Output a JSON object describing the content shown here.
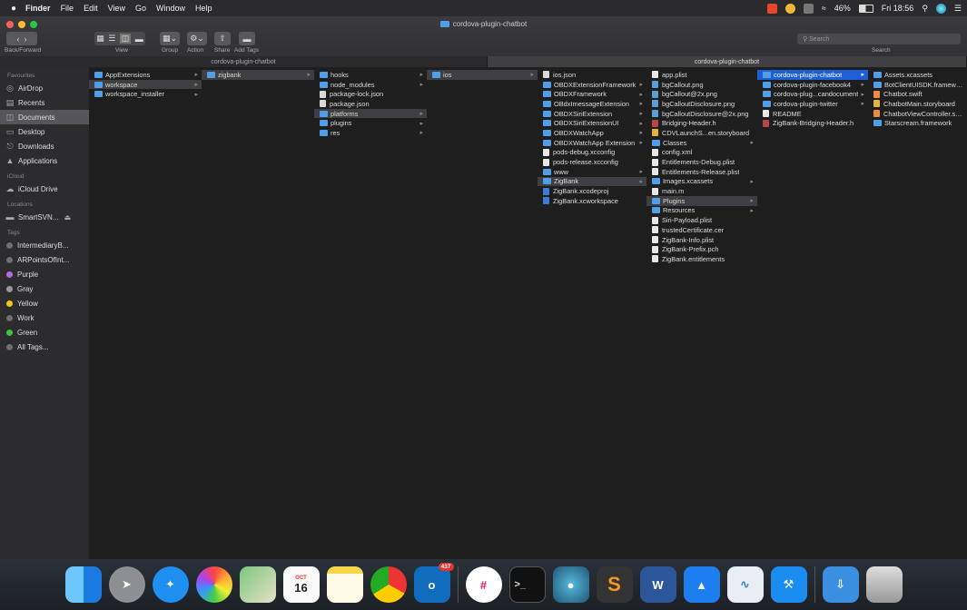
{
  "menubar": {
    "apple": "",
    "items": [
      "Finder",
      "File",
      "Edit",
      "View",
      "Go",
      "Window",
      "Help"
    ],
    "battery": "46%",
    "clock": "Fri 18:56"
  },
  "window": {
    "title": "cordova-plugin-chatbot",
    "toolbar": {
      "back_forward": "Back/Forward",
      "view": "View",
      "group": "Group",
      "action": "Action",
      "share": "Share",
      "add_tags": "Add Tags",
      "search_placeholder": "Search",
      "search_label": "Search"
    },
    "tabs": [
      "cordova-plugin-chatbot",
      "cordova-plugin-chatbot"
    ]
  },
  "sidebar": {
    "favourites_heading": "Favourites",
    "favourites": [
      "AirDrop",
      "Recents",
      "Documents",
      "Desktop",
      "Downloads",
      "Applications"
    ],
    "icloud_heading": "iCloud",
    "icloud": [
      "iCloud Drive"
    ],
    "locations_heading": "Locations",
    "locations": [
      "SmartSVN..."
    ],
    "tags_heading": "Tags",
    "tags": [
      {
        "label": "IntermediaryB...",
        "color": "#6e6e6e"
      },
      {
        "label": "ARPointsOfInt...",
        "color": "#6e6e6e"
      },
      {
        "label": "Purple",
        "color": "#b36ae2"
      },
      {
        "label": "Gray",
        "color": "#9a9a9a"
      },
      {
        "label": "Yellow",
        "color": "#f5c518"
      },
      {
        "label": "Work",
        "color": "#6e6e6e"
      },
      {
        "label": "Green",
        "color": "#3fc43f"
      },
      {
        "label": "All Tags...",
        "color": "#6e6e6e"
      }
    ]
  },
  "columns": [
    {
      "items": [
        {
          "name": "AppExtensions",
          "type": "folder",
          "arrow": true
        },
        {
          "name": "workspace",
          "type": "folder",
          "arrow": true,
          "selected": true
        },
        {
          "name": "workspace_installer",
          "type": "folder",
          "arrow": true
        }
      ]
    },
    {
      "items": [
        {
          "name": "zigbank",
          "type": "folder",
          "arrow": true,
          "selected": true
        }
      ]
    },
    {
      "items": [
        {
          "name": "hooks",
          "type": "folder",
          "arrow": true
        },
        {
          "name": "node_modules",
          "type": "folder",
          "arrow": true
        },
        {
          "name": "package-lock.json",
          "type": "json",
          "arrow": false
        },
        {
          "name": "package.json",
          "type": "json",
          "arrow": false
        },
        {
          "name": "platforms",
          "type": "folder",
          "arrow": true,
          "selected": true
        },
        {
          "name": "plugins",
          "type": "folder",
          "arrow": true
        },
        {
          "name": "res",
          "type": "folder",
          "arrow": true
        }
      ]
    },
    {
      "items": [
        {
          "name": "ios",
          "type": "folder",
          "arrow": true,
          "selected": true
        }
      ]
    },
    {
      "items": [
        {
          "name": "ios.json",
          "type": "json",
          "arrow": false
        },
        {
          "name": "OBDXExtensionFramework",
          "type": "folder",
          "arrow": true
        },
        {
          "name": "OBDXFramework",
          "type": "folder",
          "arrow": true
        },
        {
          "name": "OBdxImessageExtension",
          "type": "folder",
          "arrow": true
        },
        {
          "name": "OBDXSiriExtension",
          "type": "folder",
          "arrow": true
        },
        {
          "name": "OBDXSiriExtensionUI",
          "type": "folder",
          "arrow": true
        },
        {
          "name": "OBDXWatchApp",
          "type": "folder",
          "arrow": true
        },
        {
          "name": "OBDXWatchApp Extension",
          "type": "folder",
          "arrow": true
        },
        {
          "name": "pods-debug.xcconfig",
          "type": "doc",
          "arrow": false
        },
        {
          "name": "pods-release.xcconfig",
          "type": "doc",
          "arrow": false
        },
        {
          "name": "www",
          "type": "folder",
          "arrow": true
        },
        {
          "name": "ZigBank",
          "type": "folder",
          "arrow": true,
          "selected": true
        },
        {
          "name": "ZigBank.xcodeproj",
          "type": "xc",
          "arrow": false
        },
        {
          "name": "ZigBank.xcworkspace",
          "type": "xc",
          "arrow": false
        }
      ]
    },
    {
      "items": [
        {
          "name": "app.plist",
          "type": "doc",
          "arrow": false
        },
        {
          "name": "bgCallout.png",
          "type": "png",
          "arrow": false
        },
        {
          "name": "bgCallout@2x.png",
          "type": "png",
          "arrow": false
        },
        {
          "name": "bgCalloutDisclosure.png",
          "type": "png",
          "arrow": false
        },
        {
          "name": "bgCalloutDisclosure@2x.png",
          "type": "png",
          "arrow": false
        },
        {
          "name": "Bridging-Header.h",
          "type": "h",
          "arrow": false
        },
        {
          "name": "CDVLaunchS...en.storyboard",
          "type": "xib",
          "arrow": false
        },
        {
          "name": "Classes",
          "type": "folder",
          "arrow": true
        },
        {
          "name": "config.xml",
          "type": "doc",
          "arrow": false
        },
        {
          "name": "Entitlements-Debug.plist",
          "type": "doc",
          "arrow": false
        },
        {
          "name": "Entitlements-Release.plist",
          "type": "doc",
          "arrow": false
        },
        {
          "name": "Images.xcassets",
          "type": "folder",
          "arrow": true
        },
        {
          "name": "main.m",
          "type": "doc",
          "arrow": false
        },
        {
          "name": "Plugins",
          "type": "folder",
          "arrow": true,
          "selected": true
        },
        {
          "name": "Resources",
          "type": "folder",
          "arrow": true
        },
        {
          "name": "Siri-Payload.plist",
          "type": "doc",
          "arrow": false
        },
        {
          "name": "trustedCertificate.cer",
          "type": "doc",
          "arrow": false
        },
        {
          "name": "ZigBank-Info.plist",
          "type": "doc",
          "arrow": false
        },
        {
          "name": "ZigBank-Prefix.pch",
          "type": "doc",
          "arrow": false
        },
        {
          "name": "ZigBank.entitlements",
          "type": "doc",
          "arrow": false
        }
      ]
    },
    {
      "items": [
        {
          "name": "cordova-plugin-chatbot",
          "type": "folder",
          "arrow": true,
          "highlight": true
        },
        {
          "name": "cordova-plugin-facebook4",
          "type": "folder",
          "arrow": true
        },
        {
          "name": "cordova-plug...candocument",
          "type": "folder",
          "arrow": true
        },
        {
          "name": "cordova-plugin-twitter",
          "type": "folder",
          "arrow": true
        },
        {
          "name": "README",
          "type": "doc",
          "arrow": false
        },
        {
          "name": "ZigBank-Bridging-Header.h",
          "type": "h",
          "arrow": false
        }
      ]
    },
    {
      "items": [
        {
          "name": "Assets.xcassets",
          "type": "folder",
          "arrow": false
        },
        {
          "name": "BotClientUISDK.framework",
          "type": "folder",
          "arrow": false
        },
        {
          "name": "Chatbot.swift",
          "type": "swift",
          "arrow": false
        },
        {
          "name": "ChatbotMain.storyboard",
          "type": "xib",
          "arrow": false
        },
        {
          "name": "ChatbotViewController.swift",
          "type": "swift",
          "arrow": false
        },
        {
          "name": "Starscream.framework",
          "type": "folder",
          "arrow": false
        }
      ]
    }
  ],
  "dock": {
    "calendar_month": "OCT",
    "calendar_day": "16",
    "outlook_badge": "437"
  }
}
